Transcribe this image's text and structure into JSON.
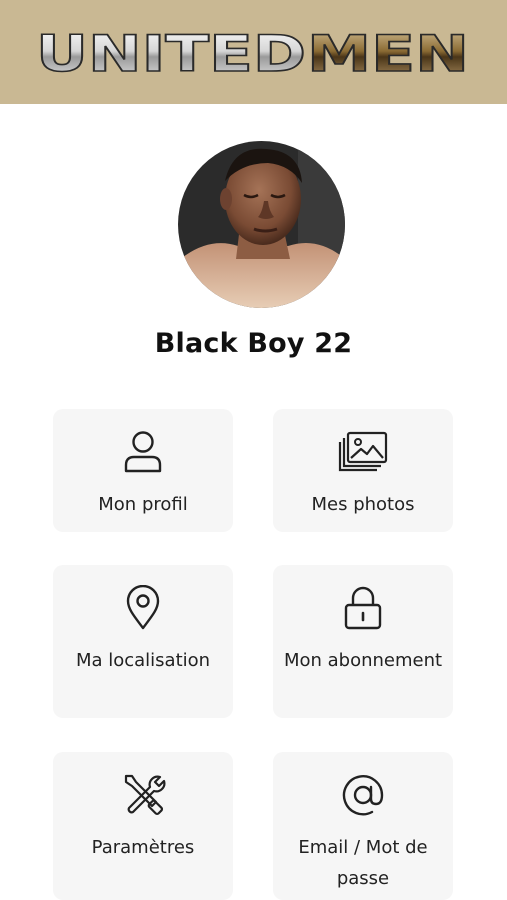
{
  "header": {
    "logo": {
      "text_united": "UNITED",
      "text_men": "MEN",
      "background_color": "#c9b893"
    }
  },
  "profile": {
    "username": "Black Boy 22",
    "avatar": {
      "icon": "avatar-photo"
    }
  },
  "menu": {
    "items": [
      {
        "label": "Mon profil",
        "icon": "user-icon"
      },
      {
        "label": "Mes photos",
        "icon": "photos-icon"
      },
      {
        "label": "Ma localisation",
        "icon": "location-pin-icon"
      },
      {
        "label": "Mon abonnement",
        "icon": "lock-icon"
      },
      {
        "label": "Paramètres",
        "icon": "tools-icon"
      },
      {
        "label": "Email / Mot de passe",
        "icon": "at-sign-icon"
      }
    ]
  }
}
